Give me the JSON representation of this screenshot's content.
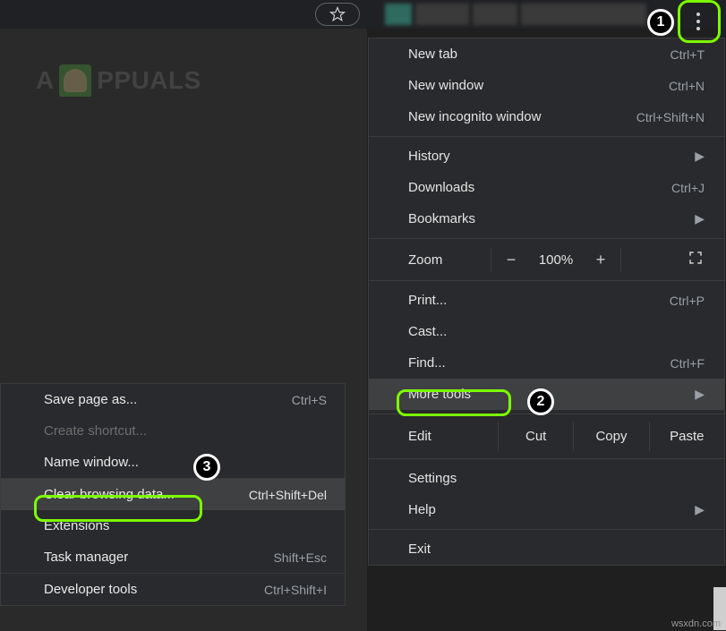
{
  "logo": {
    "text": "PPUALS"
  },
  "main_menu": {
    "new_tab": {
      "label": "New tab",
      "shortcut": "Ctrl+T"
    },
    "new_window": {
      "label": "New window",
      "shortcut": "Ctrl+N"
    },
    "new_incognito": {
      "label": "New incognito window",
      "shortcut": "Ctrl+Shift+N"
    },
    "history": {
      "label": "History"
    },
    "downloads": {
      "label": "Downloads",
      "shortcut": "Ctrl+J"
    },
    "bookmarks": {
      "label": "Bookmarks"
    },
    "zoom": {
      "label": "Zoom",
      "minus": "−",
      "value": "100%",
      "plus": "+"
    },
    "print": {
      "label": "Print...",
      "shortcut": "Ctrl+P"
    },
    "cast": {
      "label": "Cast..."
    },
    "find": {
      "label": "Find...",
      "shortcut": "Ctrl+F"
    },
    "more_tools": {
      "label": "More tools"
    },
    "edit": {
      "label": "Edit",
      "cut": "Cut",
      "copy": "Copy",
      "paste": "Paste"
    },
    "settings": {
      "label": "Settings"
    },
    "help": {
      "label": "Help"
    },
    "exit": {
      "label": "Exit"
    }
  },
  "sub_menu": {
    "save_as": {
      "label": "Save page as...",
      "shortcut": "Ctrl+S"
    },
    "create_shortcut": {
      "label": "Create shortcut..."
    },
    "name_window": {
      "label": "Name window..."
    },
    "clear_data": {
      "label": "Clear browsing data...",
      "shortcut": "Ctrl+Shift+Del"
    },
    "extensions": {
      "label": "Extensions"
    },
    "task_manager": {
      "label": "Task manager",
      "shortcut": "Shift+Esc"
    },
    "dev_tools": {
      "label": "Developer tools",
      "shortcut": "Ctrl+Shift+I"
    }
  },
  "steps": {
    "one": "1",
    "two": "2",
    "three": "3"
  },
  "watermark": "wsxdn.com"
}
